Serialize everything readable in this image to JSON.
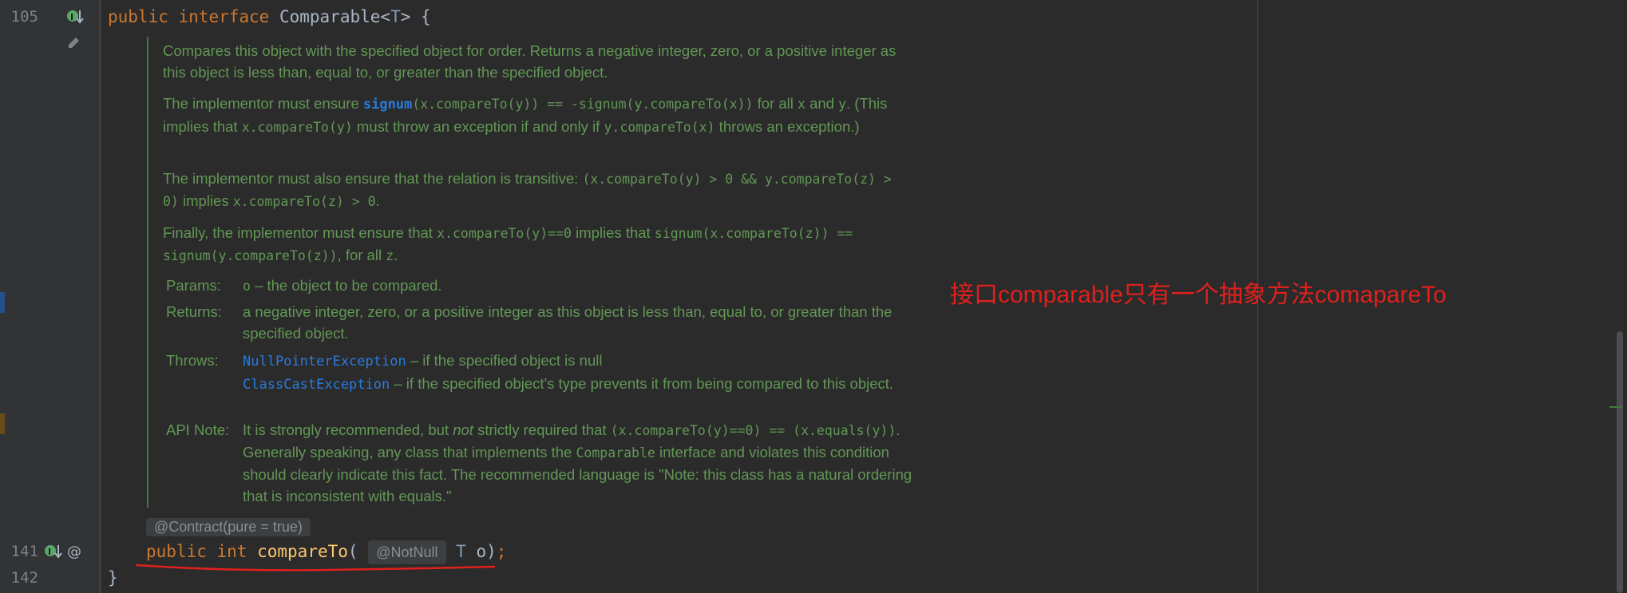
{
  "gutter": {
    "line_105": "105",
    "line_141": "141",
    "line_142": "142"
  },
  "code": {
    "line_105": {
      "kw1": "public",
      "kw2": "interface",
      "name": "Comparable",
      "lt": "<",
      "tparam": "T",
      "rest": "> {"
    },
    "annotation": "@Contract(pure = true)",
    "line_141": {
      "kw1": "public",
      "kw2": "int",
      "method": "compareTo",
      "open": "(",
      "param_annot": "@NotNull",
      "ptype": "T",
      "pname": "o",
      "close": ")",
      "semi": ";"
    },
    "line_142": "}"
  },
  "doc": {
    "p1": "Compares this object with the specified object for order. Returns a negative integer, zero, or a positive integer as this object is less than, equal to, or greater than the specified object.",
    "p2_a": "The implementor must ensure ",
    "p2_link": "signum",
    "p2_c1": "(x.compareTo(y)) == -signum(y.compareTo(x))",
    "p2_b": " for all ",
    "p2_c2": "x",
    "p2_c": " and ",
    "p2_c3": "y",
    "p2_d": ". (This implies that ",
    "p2_c4": "x.compareTo(y)",
    "p2_e": " must throw an exception if and only if ",
    "p2_c5": "y.compareTo(x)",
    "p2_f": " throws an exception.)",
    "p3_a": "The implementor must also ensure that the relation is transitive: ",
    "p3_c1": "(x.compareTo(y) > 0 && y.compareTo(z) > 0)",
    "p3_b": " implies ",
    "p3_c2": "x.compareTo(z) > 0",
    "p3_c": ".",
    "p4_a": "Finally, the implementor must ensure that ",
    "p4_c1": "x.compareTo(y)==0",
    "p4_b": " implies that ",
    "p4_c2": "signum(x.compareTo(z)) == signum(y.compareTo(z))",
    "p4_c": ", for all ",
    "p4_c3": "z",
    "p4_d": ".",
    "params_label": "Params:",
    "params_code": "o",
    "params_text": " – the object to be compared.",
    "returns_label": "Returns:",
    "returns_text": "a negative integer, zero, or a positive integer as this object is less than, equal to, or greater than the specified object.",
    "throws_label": "Throws:",
    "throws_1_link": "NullPointerException",
    "throws_1_text": " – if the specified object is null",
    "throws_2_link": "ClassCastException",
    "throws_2_text": " – if the specified object's type prevents it from being compared to this object.",
    "apinote_label": "API Note:",
    "apinote_a": "It is strongly recommended, but ",
    "apinote_em": "not",
    "apinote_b": " strictly required that ",
    "apinote_c1": "(x.compareTo(y)==0) == (x.equals(y))",
    "apinote_c": ". Generally speaking, any class that implements the ",
    "apinote_c2": "Comparable",
    "apinote_d": " interface and violates this condition should clearly indicate this fact. The recommended language is \"Note: this class has a natural ordering that is inconsistent with equals.\""
  },
  "overlay_note": "接口comparable只有一个抽象方法comapareTo",
  "colors": {
    "background": "#2b2b2b",
    "keyword": "#cc7832",
    "method": "#ffc66d",
    "doc_text": "#629755",
    "doc_link": "#287bde",
    "note": "#e0201c"
  }
}
